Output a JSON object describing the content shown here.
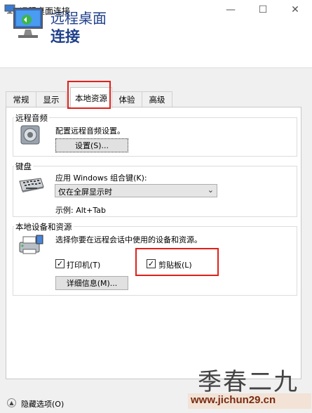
{
  "window": {
    "title": "远程桌面连接"
  },
  "header": {
    "line1": "远程桌面",
    "line2": "连接"
  },
  "tabs": [
    {
      "label": "常规"
    },
    {
      "label": "显示"
    },
    {
      "label": "本地资源",
      "selected": true
    },
    {
      "label": "体验"
    },
    {
      "label": "高级"
    }
  ],
  "audio": {
    "group_title": "远程音频",
    "description": "配置远程音频设置。",
    "settings_button": "设置(S)..."
  },
  "keyboard": {
    "group_title": "键盘",
    "label": "应用 Windows 组合键(K):",
    "selected_option": "仅在全屏显示时",
    "example": "示例: Alt+Tab"
  },
  "devices": {
    "group_title": "本地设备和资源",
    "description": "选择你要在远程会话中使用的设备和资源。",
    "printer_label": "打印机(T)",
    "printer_checked": true,
    "clipboard_label": "剪贴板(L)",
    "clipboard_checked": true,
    "details_button": "详细信息(M)..."
  },
  "footer": {
    "hide_options": "隐藏选项(O)"
  },
  "watermark": {
    "text": "季春二九",
    "url": "www.jichun29.cn"
  },
  "colors": {
    "highlight": "#e0201b",
    "header_text": "#1e3f8a"
  }
}
